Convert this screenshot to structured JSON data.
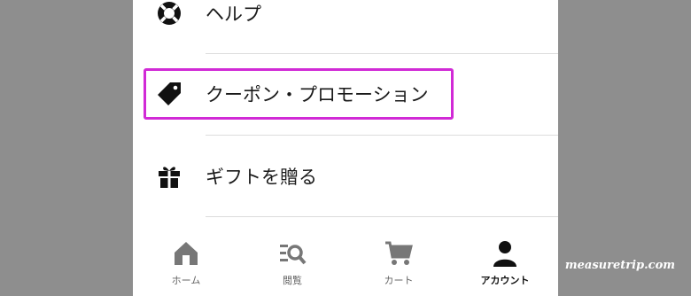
{
  "menu": {
    "items": [
      {
        "label": "ヘルプ",
        "icon": "lifebuoy-icon"
      },
      {
        "label": "クーポン・プロモーション",
        "icon": "tag-icon",
        "highlighted": true
      },
      {
        "label": "ギフトを贈る",
        "icon": "gift-icon"
      }
    ]
  },
  "highlight_color": "#d12ad6",
  "bottom_nav": {
    "items": [
      {
        "label": "ホーム",
        "icon": "home-icon",
        "active": false
      },
      {
        "label": "閲覧",
        "icon": "browse-search-icon",
        "active": false
      },
      {
        "label": "カート",
        "icon": "cart-icon",
        "active": false
      },
      {
        "label": "アカウント",
        "icon": "account-icon",
        "active": true
      }
    ]
  },
  "watermark": "measuretrip.com"
}
